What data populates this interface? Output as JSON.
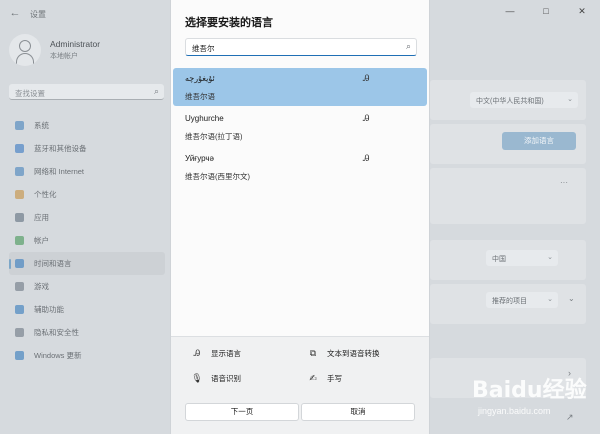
{
  "window": {
    "title": "设置",
    "controls": [
      "—",
      "□",
      "✕"
    ]
  },
  "profile": {
    "name": "Administrator",
    "account_type": "本地帐户"
  },
  "settings_search": {
    "placeholder": "查找设置"
  },
  "nav": {
    "items": [
      {
        "label": "系统",
        "icon": "system-icon",
        "color": "#5a8fc0"
      },
      {
        "label": "蓝牙和其他设备",
        "icon": "bluetooth-icon",
        "color": "#4f86c6"
      },
      {
        "label": "网络和 Internet",
        "icon": "wifi-icon",
        "color": "#5a8fc0"
      },
      {
        "label": "个性化",
        "icon": "brush-icon",
        "color": "#c89a56"
      },
      {
        "label": "应用",
        "icon": "apps-icon",
        "color": "#6f7e8c"
      },
      {
        "label": "帐户",
        "icon": "account-icon",
        "color": "#58a06a"
      },
      {
        "label": "时间和语言",
        "icon": "time-language-icon",
        "color": "#4a87c1",
        "active": true
      },
      {
        "label": "游戏",
        "icon": "gaming-icon",
        "color": "#7a8590"
      },
      {
        "label": "辅助功能",
        "icon": "accessibility-icon",
        "color": "#4a87c1"
      },
      {
        "label": "隐私和安全性",
        "icon": "shield-icon",
        "color": "#7a8590"
      },
      {
        "label": "Windows 更新",
        "icon": "update-icon",
        "color": "#4a87c1"
      }
    ]
  },
  "background": {
    "dropdown_display_language": "中文(中华人民共和国)",
    "add_language_button": "添加语言",
    "more_button": "···",
    "dropdown_region": "中国",
    "dropdown_format": "推荐的项目"
  },
  "dialog": {
    "title": "选择要安装的语言",
    "search_value": "维吾尔",
    "languages": [
      {
        "name": "ئۇيغۇرچە",
        "sub": "维吾尔语",
        "selected": true,
        "rtl": true
      },
      {
        "name": "Uyghurche",
        "sub": "维吾尔语(拉丁语)",
        "selected": false,
        "rtl": false
      },
      {
        "name": "Уйғурчә",
        "sub": "维吾尔语(西里尔文)",
        "selected": false,
        "rtl": false
      }
    ],
    "legend": {
      "display_language": "显示语言",
      "text_to_speech": "文本到语音转换",
      "speech_recognition": "语音识别",
      "handwriting": "手写"
    },
    "next_button": "下一页",
    "cancel_button": "取消"
  },
  "watermark": {
    "brand": "Baidu经验",
    "url": "jingyan.baidu.com"
  }
}
